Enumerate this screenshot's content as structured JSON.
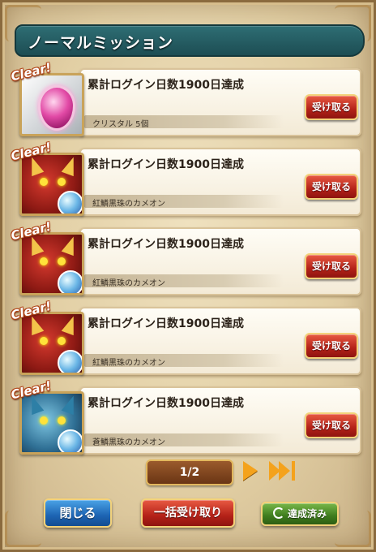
{
  "header": {
    "title": "ノーマルミッション"
  },
  "clear_label": "Clear!",
  "missions": [
    {
      "title": "累計ログイン日数1900日達成",
      "reward": "クリスタル 5個",
      "button": "受け取る",
      "thumb": "crystal"
    },
    {
      "title": "累計ログイン日数1900日達成",
      "reward": "紅鱗黒珠のカメオン",
      "button": "受け取る",
      "thumb": "red-monster"
    },
    {
      "title": "累計ログイン日数1900日達成",
      "reward": "紅鱗黒珠のカメオン",
      "button": "受け取る",
      "thumb": "red-monster"
    },
    {
      "title": "累計ログイン日数1900日達成",
      "reward": "紅鱗黒珠のカメオン",
      "button": "受け取る",
      "thumb": "red-monster"
    },
    {
      "title": "累計ログイン日数1900日達成",
      "reward": "蒼鱗黒珠のカメオン",
      "button": "受け取る",
      "thumb": "blue-monster"
    }
  ],
  "pager": {
    "label": "1/2"
  },
  "footer": {
    "close_label": "閉じる",
    "bulk_label": "一括受け取り",
    "done_label": "達成済み"
  },
  "colors": {
    "header": "#1d4d53",
    "receive_button": "#b52218",
    "close_button": "#1d64b3",
    "done_button": "#3e7c1d",
    "arrow": "#f4a21c"
  }
}
